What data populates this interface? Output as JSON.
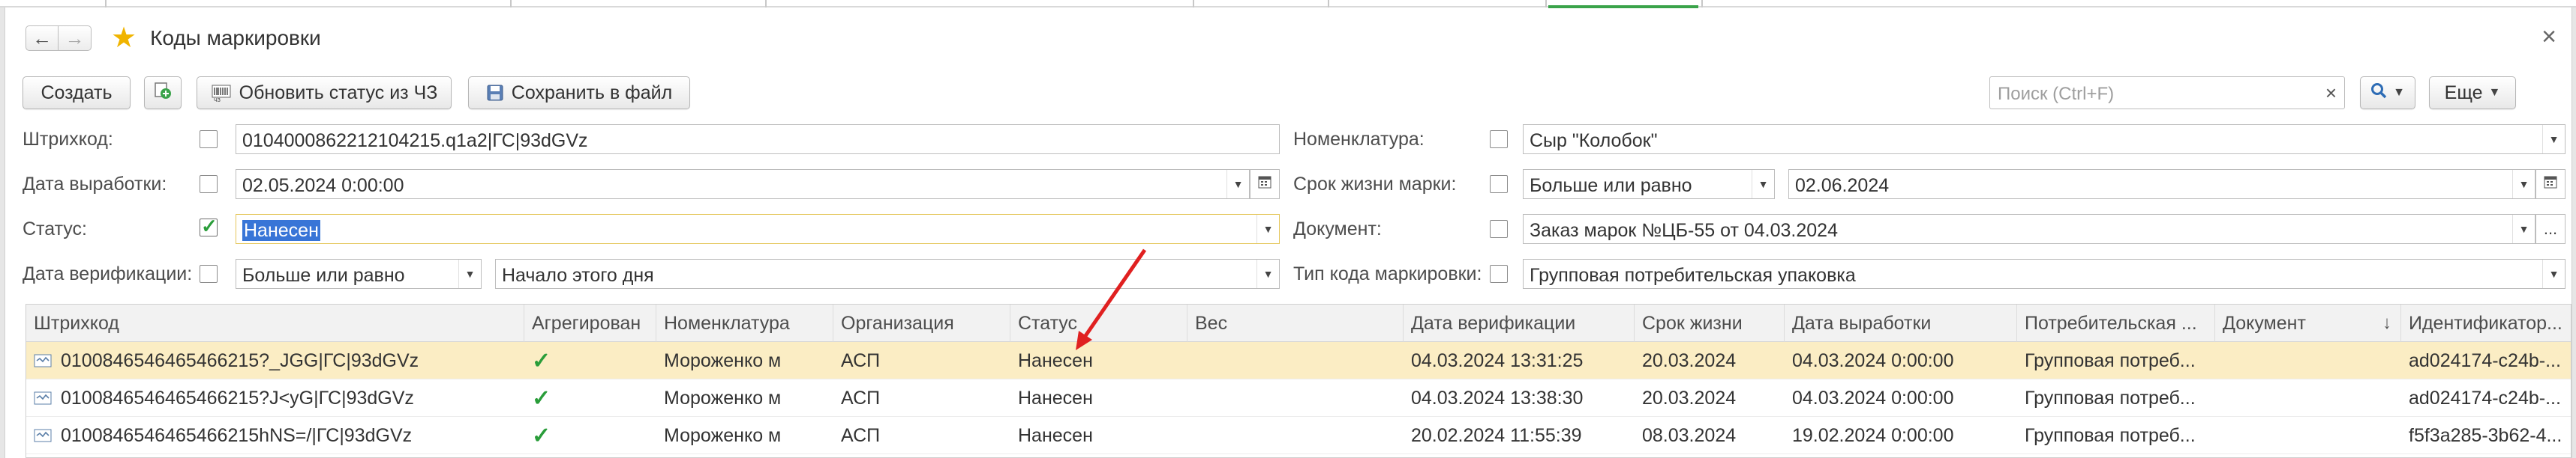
{
  "window": {
    "title": "Коды маркировки"
  },
  "toolbar": {
    "create_label": "Создать",
    "update_status_label": "Обновить статус из ЧЗ",
    "save_file_label": "Сохранить в файл",
    "search_placeholder": "Поиск (Ctrl+F)",
    "more_label": "Еще"
  },
  "filters": {
    "barcode": {
      "label": "Штрихкод:",
      "checked": false,
      "value": "0104000862212104215.q1a2|ГС|93dGVz"
    },
    "production_date": {
      "label": "Дата выработки:",
      "checked": false,
      "value": "02.05.2024  0:00:00"
    },
    "status": {
      "label": "Статус:",
      "checked": true,
      "value": "Нанесен"
    },
    "verification_date": {
      "label": "Дата верификации:",
      "checked": false,
      "operator": "Больше или равно",
      "value": "Начало этого дня"
    },
    "nomenclature": {
      "label": "Номенклатура:",
      "checked": false,
      "value": "Сыр \"Колобок\""
    },
    "shelf_life": {
      "label": "Срок жизни марки:",
      "checked": false,
      "operator": "Больше или равно",
      "value": "02.06.2024"
    },
    "document": {
      "label": "Документ:",
      "checked": false,
      "value": "Заказ марок №ЦБ-55 от 04.03.2024"
    },
    "code_type": {
      "label": "Тип кода маркировки:",
      "checked": false,
      "value": "Групповая потребительская упаковка"
    }
  },
  "table": {
    "columns": [
      "Штрихкод",
      "Агрегирован",
      "Номенклатура",
      "Организация",
      "Статус",
      "Вес",
      "Дата верификации",
      "Срок жизни",
      "Дата выработки",
      "Потребительская ...",
      "Документ",
      "Идентификатор..."
    ],
    "rows": [
      {
        "barcode": "0100846546465466215?_JGG|ГС|93dGVz",
        "aggregated": "✓",
        "nomenclature": "Мороженко м",
        "organization": "АСП",
        "status": "Нанесен",
        "weight": "",
        "verification_date": "04.03.2024 13:31:25",
        "shelf_life": "20.03.2024",
        "production_date": "04.03.2024 0:00:00",
        "consumer": "Групповая потреб...",
        "document": "",
        "identifier": "ad024174-c24b-..."
      },
      {
        "barcode": "0100846546465466215?J<yG|ГС|93dGVz",
        "aggregated": "✓",
        "nomenclature": "Мороженко м",
        "organization": "АСП",
        "status": "Нанесен",
        "weight": "",
        "verification_date": "04.03.2024 13:38:30",
        "shelf_life": "20.03.2024",
        "production_date": "04.03.2024 0:00:00",
        "consumer": "Групповая потреб...",
        "document": "",
        "identifier": "ad024174-c24b-..."
      },
      {
        "barcode": "0100846546465466215hNS=/|ГС|93dGVz",
        "aggregated": "✓",
        "nomenclature": "Мороженко м",
        "organization": "АСП",
        "status": "Нанесен",
        "weight": "",
        "verification_date": "20.02.2024 11:55:39",
        "shelf_life": "08.03.2024",
        "production_date": "19.02.2024 0:00:00",
        "consumer": "Групповая потреб...",
        "document": "",
        "identifier": "f5f3a285-3b62-4..."
      }
    ]
  },
  "colors": {
    "accent_star": "#f0b400",
    "selected_row": "#fbedc4",
    "check_green": "#2a9d3a",
    "annotation_arrow": "#e02020",
    "selection_highlight": "#3875d7"
  },
  "icons": {
    "back": "arrow-left-icon",
    "forward": "arrow-right-icon",
    "favorite": "star-icon",
    "close": "close-icon",
    "add_copy": "add-copy-icon",
    "update_status": "barcode-refresh-icon",
    "save": "floppy-disk-icon",
    "search": "search-icon",
    "calendar": "calendar-icon",
    "row": "barcode-row-icon"
  }
}
